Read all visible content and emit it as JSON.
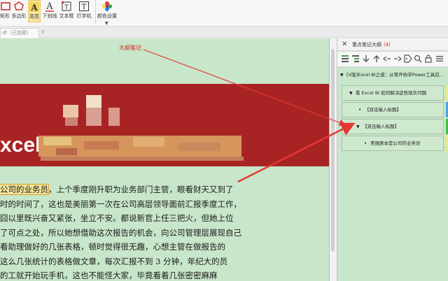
{
  "toolbar": {
    "tools": [
      {
        "id": "rect",
        "label": "矩形",
        "icon": "rectangle-icon"
      },
      {
        "id": "polygon",
        "label": "多边形",
        "icon": "polygon-icon"
      },
      {
        "id": "highlight",
        "label": "高亮",
        "icon": "highlight-icon",
        "active": true
      },
      {
        "id": "underline",
        "label": "下划线",
        "icon": "underline-icon"
      },
      {
        "id": "textbox",
        "label": "文本框",
        "icon": "textbox-icon"
      },
      {
        "id": "typewriter",
        "label": "打字机",
        "icon": "typewriter-icon"
      },
      {
        "id": "color",
        "label": "颜色设置",
        "icon": "color-palette-icon"
      }
    ]
  },
  "tabs": {
    "doc_tab_label": "df（已加密）",
    "close_glyph": "×"
  },
  "document": {
    "banner_text": "xcel",
    "highlight_text": "公司的业务员",
    "lines": [
      {
        "before": "",
        "hl": true,
        "after": "，上个季度刚升职为业务部门主管，眼看财天又到了"
      },
      {
        "before": "时的时间了，这也是美丽第一次在公司高层领导面前汇报季度工作，",
        "hl": false
      },
      {
        "before": "囧以里既兴奋又紧张，坐立不安。都说新官上任三把火，但她上位",
        "hl": false
      },
      {
        "before": "了可点之处，所以她想借助这次报告的机会，向公司管理层展现自己",
        "hl": false
      },
      {
        "before": "看助理做好的几张表格，顿时觉得很无趣，心想主管在做报告的",
        "hl": false
      },
      {
        "before": "这么几张统计的表格做文章，每次汇报不到 3 分钟，年纪大的员",
        "hl": false
      },
      {
        "before": "的工就开始玩手机，这也不能怪大家，毕竟看着几张密密麻麻",
        "hl": false
      }
    ],
    "callout_label": "大纲笔记"
  },
  "panel": {
    "close_glyph": "✕",
    "title": "重点笔记大纲",
    "count": "(4)",
    "tree": [
      {
        "level": 0,
        "type": "caret",
        "text": "[V版]Excel BI之道：从零开始学Power工具应...",
        "marker": null
      },
      {
        "level": 1,
        "type": "caret",
        "text": "看 Excel BI 如何解决这些现实问题",
        "marker": "#f0e68c"
      },
      {
        "level": 2,
        "type": "bullet",
        "text": "【双击输入标题】",
        "marker": "#4aa3e0"
      },
      {
        "level": 1,
        "type": "caret",
        "text": "【双击输入标题】",
        "marker": "#3ec13e"
      },
      {
        "level": 2,
        "type": "bullet",
        "text": "美丽原本是公司的业务员",
        "marker": "#f0e68c"
      }
    ]
  },
  "colors": {
    "doc_background": "#c8e6c9",
    "banner": "#a82424",
    "arrow": "#e53935",
    "highlight": "#f3e69a"
  }
}
